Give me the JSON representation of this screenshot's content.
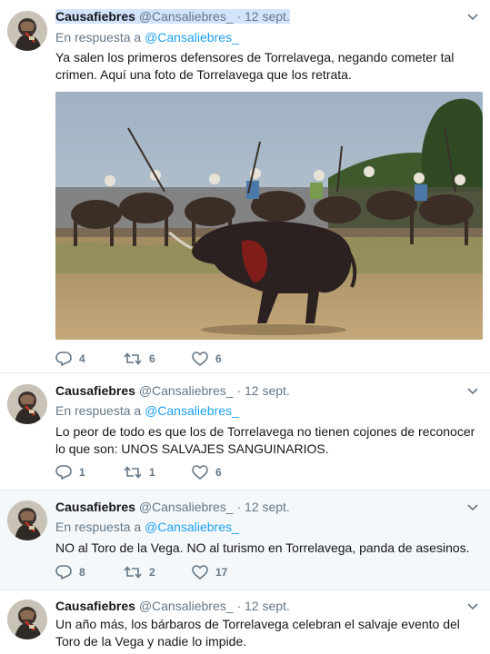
{
  "colors": {
    "accent": "#1da1f2",
    "secondary_text": "#657786",
    "divider": "#e6ecf0",
    "selection": "#d2e3fc"
  },
  "icons": [
    "chevron-down-icon",
    "reply-icon",
    "retweet-icon",
    "like-icon"
  ],
  "tweets": [
    {
      "name": "Causafiebres",
      "handle": "@Cansaliebres_",
      "date": "· 12 sept.",
      "reply_prefix": "En respuesta a",
      "reply_to": "@Cansaliebres_",
      "text": "Ya salen los primeros defensores de Torrelavega, negando cometer tal crimen. Aquí una foto de Torrelavega que los retrata.",
      "replies": "4",
      "retweets": "6",
      "likes": "6"
    },
    {
      "name": "Causafiebres",
      "handle": "@Cansaliebres_",
      "date": "· 12 sept.",
      "reply_prefix": "En respuesta a",
      "reply_to": "@Cansaliebres_",
      "text": "Lo peor de todo es que los de Torrelavega no tienen cojones de reconocer lo que son: UNOS SALVAJES SANGUINARIOS.",
      "replies": "1",
      "retweets": "1",
      "likes": "6"
    },
    {
      "name": "Causafiebres",
      "handle": "@Cansaliebres_",
      "date": "· 12 sept.",
      "reply_prefix": "En respuesta a",
      "reply_to": "@Cansaliebres_",
      "text": "NO al Toro de la Vega. NO al turismo en Torrelavega, panda de asesinos.",
      "replies": "8",
      "retweets": "2",
      "likes": "17"
    },
    {
      "name": "Causafiebres",
      "handle": "@Cansaliebres_",
      "date": "· 12 sept.",
      "text": "Un año más, los bárbaros de Torrelavega celebran el salvaje evento del Toro de la Vega y nadie lo impide."
    }
  ]
}
